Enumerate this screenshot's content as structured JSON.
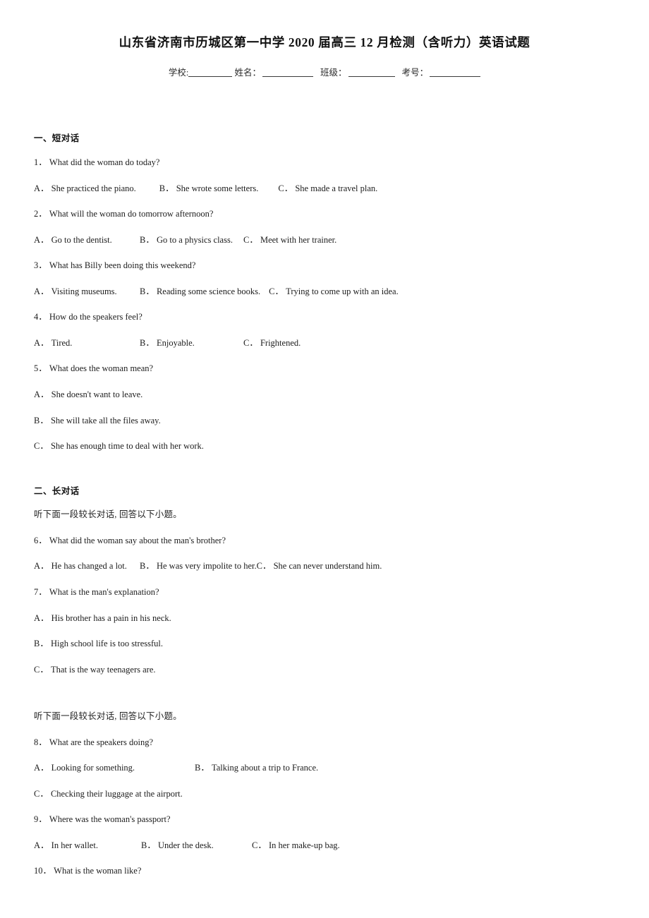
{
  "document": {
    "title": "山东省济南市历城区第一中学 2020 届高三 12 月检测（含听力）英语试题",
    "info": {
      "school_label": "学校:",
      "name_label": "姓名：",
      "class_label": "班级：",
      "exam_no_label": "考号："
    }
  },
  "sections": [
    {
      "heading": "一、短对话",
      "questions": [
        {
          "number": "1．",
          "text": "What did the woman do today?",
          "options": [
            {
              "letter": "A．",
              "text": "She practiced the piano."
            },
            {
              "letter": "B．",
              "text": "She wrote some letters."
            },
            {
              "letter": "C．",
              "text": "She made a travel plan."
            }
          ]
        },
        {
          "number": "2．",
          "text": "What will the woman do tomorrow afternoon?",
          "options": [
            {
              "letter": "A．",
              "text": "Go to the dentist."
            },
            {
              "letter": "B．",
              "text": "Go to a physics class."
            },
            {
              "letter": "C．",
              "text": "Meet with her trainer."
            }
          ]
        },
        {
          "number": "3．",
          "text": "What has Billy been doing this weekend?",
          "options": [
            {
              "letter": "A．",
              "text": "Visiting museums."
            },
            {
              "letter": "B．",
              "text": "Reading some science books."
            },
            {
              "letter": "C．",
              "text": "Trying to come up with an idea."
            }
          ]
        },
        {
          "number": "4．",
          "text": "How do the speakers feel?",
          "options": [
            {
              "letter": "A．",
              "text": "Tired."
            },
            {
              "letter": "B．",
              "text": "Enjoyable."
            },
            {
              "letter": "C．",
              "text": "Frightened."
            }
          ]
        },
        {
          "number": "5．",
          "text": "What does the woman mean?",
          "options": [
            {
              "letter": "A．",
              "text": "She doesn't want to leave."
            },
            {
              "letter": "B．",
              "text": "She will take all the files away."
            },
            {
              "letter": "C．",
              "text": "She has enough time to deal with her work."
            }
          ]
        }
      ]
    },
    {
      "heading": "二、长对话",
      "directive_1": "听下面一段较长对话, 回答以下小题。",
      "directive_2": "听下面一段较长对话, 回答以下小题。",
      "questions": [
        {
          "number": "6．",
          "text": "What did the woman say about the man's brother?",
          "options": [
            {
              "letter": "A．",
              "text": "He has changed a lot."
            },
            {
              "letter": "B．",
              "text": "He was very impolite to her."
            },
            {
              "letter": "C．",
              "text": "She can never understand him."
            }
          ]
        },
        {
          "number": "7．",
          "text": "What is the man's explanation?",
          "options": [
            {
              "letter": "A．",
              "text": "His brother has a pain in his neck."
            },
            {
              "letter": "B．",
              "text": "High school life is too stressful."
            },
            {
              "letter": "C．",
              "text": "That is the way teenagers are."
            }
          ]
        },
        {
          "number": "8．",
          "text": "What are the speakers doing?",
          "options": [
            {
              "letter": "A．",
              "text": "Looking for something."
            },
            {
              "letter": "B．",
              "text": "Talking about a trip to France."
            },
            {
              "letter": "C．",
              "text": "Checking their luggage at the airport."
            }
          ]
        },
        {
          "number": "9．",
          "text": "Where was the woman's passport?",
          "options": [
            {
              "letter": "A．",
              "text": "In her wallet."
            },
            {
              "letter": "B．",
              "text": "Under the desk."
            },
            {
              "letter": "C．",
              "text": "In her make-up bag."
            }
          ]
        },
        {
          "number": "10．",
          "text": "What is the woman like?",
          "options": []
        }
      ]
    }
  ]
}
